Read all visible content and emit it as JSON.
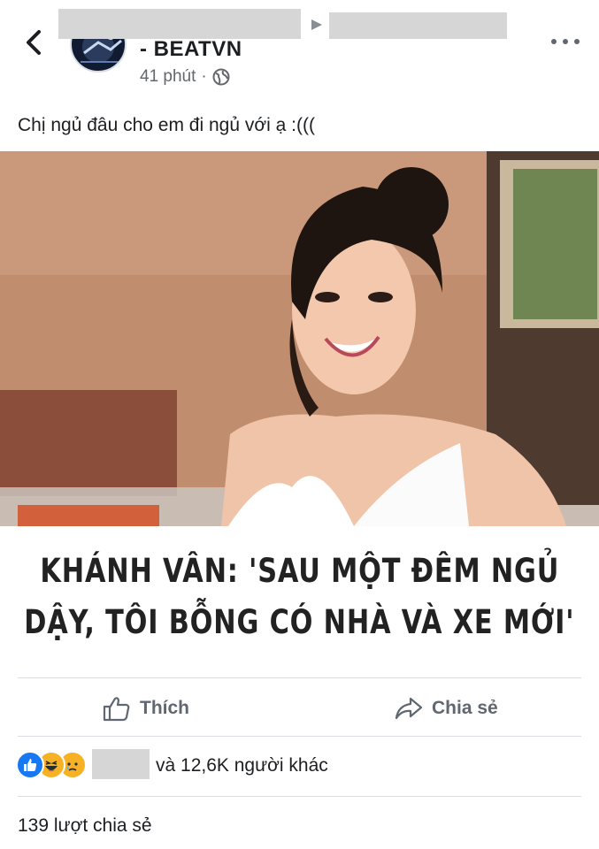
{
  "header": {
    "back_icon": "chevron-left-icon",
    "page_name": "- BEATVN",
    "time": "41 phút",
    "separator": "·",
    "privacy_icon": "globe-icon",
    "more_icon": "ellipsis-icon"
  },
  "post": {
    "caption": "Chị ngủ đâu cho em đi ngủ với ạ :(((",
    "headline_line1": "KHÁNH VÂN: 'SAU MỘT ĐÊM NGỦ",
    "headline_line2": "DẬY, TÔI BỖNG CÓ NHÀ VÀ XE MỚI'"
  },
  "actions": {
    "like_label": "Thích",
    "share_label": "Chia sẻ"
  },
  "reactions": {
    "icons": [
      "like-reaction-icon",
      "haha-reaction-icon",
      "sad-reaction-icon"
    ],
    "others_text": "và 12,6K người khác"
  },
  "shares_count": "139 lượt chia sẻ",
  "colors": {
    "like_blue": "#1877f2",
    "reaction_yellow": "#f7b125",
    "secondary_text": "#65676b"
  }
}
